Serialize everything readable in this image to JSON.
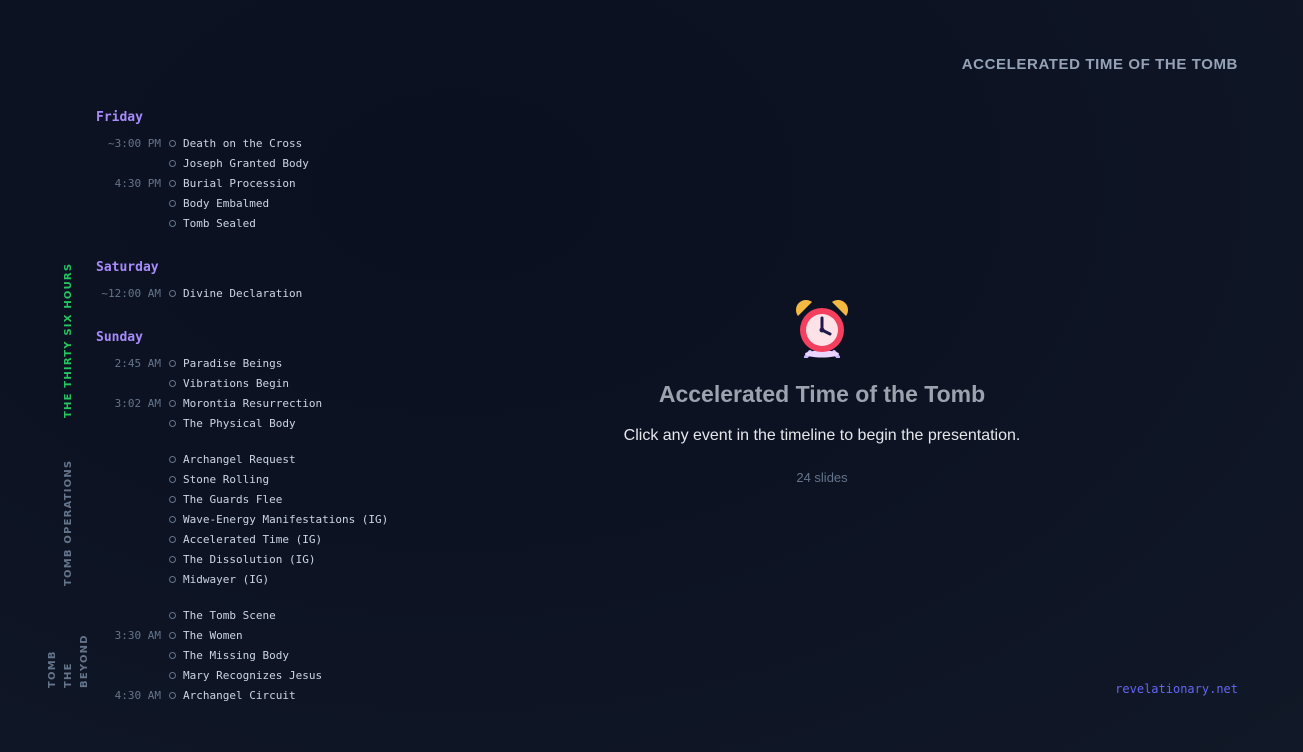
{
  "header": {
    "title": "ACCELERATED TIME OF THE TOMB"
  },
  "sidebar": {
    "tabs": [
      {
        "label": "THE THIRTY SIX HOURS",
        "active": true
      },
      {
        "label": "TOMB OPERATIONS",
        "active": false
      },
      {
        "label_lines": [
          "BEYOND",
          "THE",
          "TOMB"
        ],
        "active": false
      }
    ]
  },
  "timeline": {
    "days": [
      {
        "label": "Friday"
      },
      {
        "label": "Saturday"
      },
      {
        "label": "Sunday"
      }
    ],
    "events": [
      {
        "time": "~3:00 PM",
        "label": "Death on the Cross"
      },
      {
        "time": "",
        "label": "Joseph Granted Body"
      },
      {
        "time": "4:30 PM",
        "label": "Burial Procession"
      },
      {
        "time": "",
        "label": "Body Embalmed"
      },
      {
        "time": "",
        "label": "Tomb Sealed"
      },
      {
        "time": "~12:00 AM",
        "label": "Divine Declaration"
      },
      {
        "time": "2:45 AM",
        "label": "Paradise Beings"
      },
      {
        "time": "",
        "label": "Vibrations Begin"
      },
      {
        "time": "3:02 AM",
        "label": "Morontia Resurrection"
      },
      {
        "time": "",
        "label": "The Physical Body"
      },
      {
        "time": "",
        "label": "Archangel Request"
      },
      {
        "time": "",
        "label": "Stone Rolling"
      },
      {
        "time": "",
        "label": "The Guards Flee"
      },
      {
        "time": "",
        "label": "Wave-Energy Manifestations (IG)"
      },
      {
        "time": "",
        "label": "Accelerated Time (IG)"
      },
      {
        "time": "",
        "label": "The Dissolution (IG)"
      },
      {
        "time": "",
        "label": "Midwayer (IG)"
      },
      {
        "time": "",
        "label": "The Tomb Scene"
      },
      {
        "time": "3:30 AM",
        "label": "The Women"
      },
      {
        "time": "",
        "label": "The Missing Body"
      },
      {
        "time": "",
        "label": "Mary Recognizes Jesus"
      },
      {
        "time": "4:30 AM",
        "label": "Archangel Circuit"
      }
    ]
  },
  "main": {
    "icon": "alarm-clock-icon",
    "title": "Accelerated Time of the Tomb",
    "description": "Click any event in the timeline to begin the presentation.",
    "slide_count": "24 slides"
  },
  "footer": {
    "link": "revelationary.net"
  },
  "colors": {
    "accent_day": "#a78bfa",
    "active_tab": "#22c55e",
    "link": "#6366f1"
  }
}
